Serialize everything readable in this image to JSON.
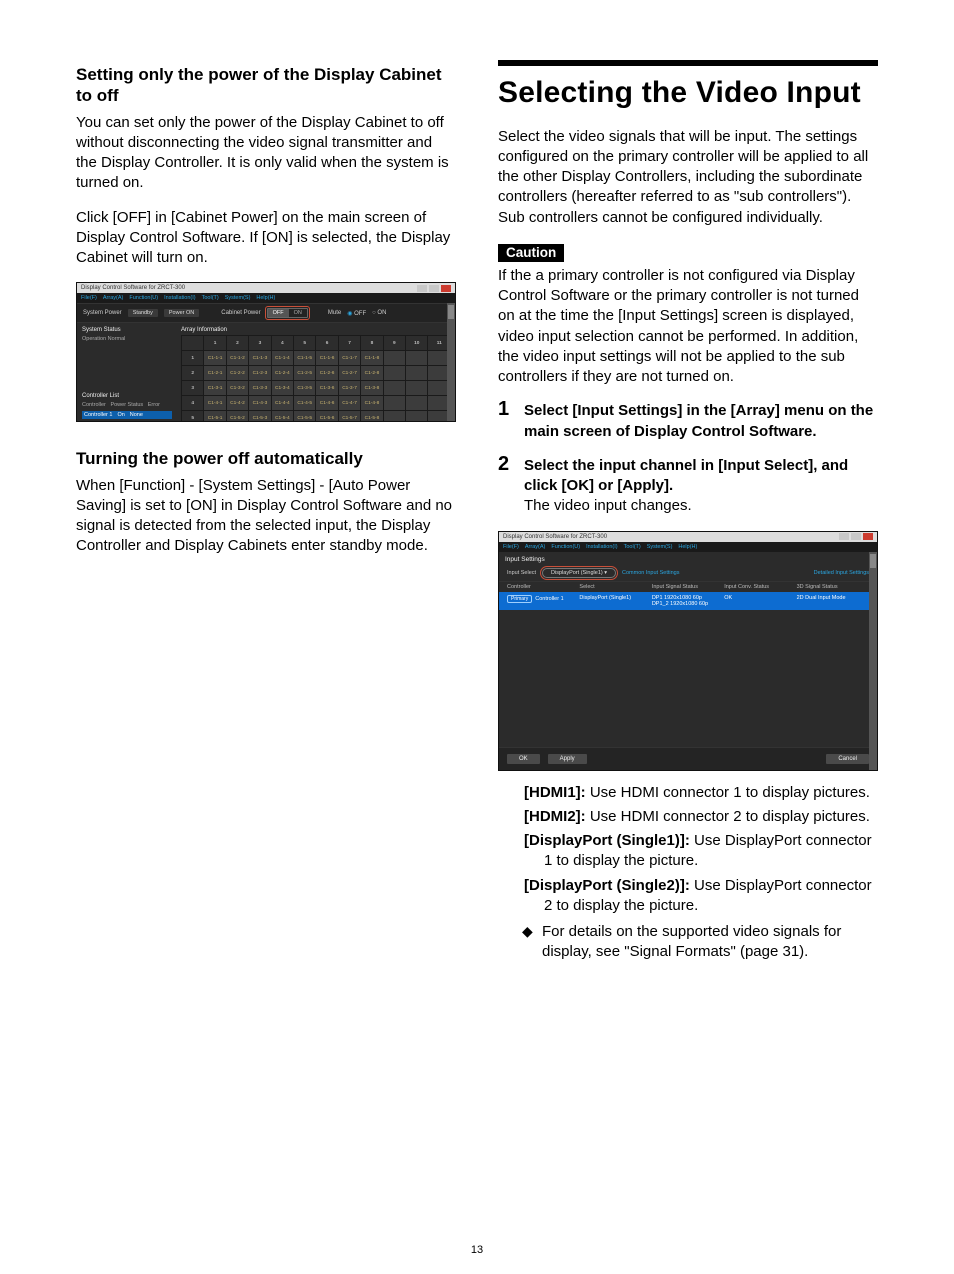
{
  "page_number": "13",
  "left": {
    "heading1": "Setting only the power of the Display Cabinet to off",
    "para1": "You can set only the power of the Display Cabinet to off without disconnecting the video signal transmitter and the Display Controller. It is only valid when the system is turned on.",
    "para2": "Click [OFF] in [Cabinet Power] on the main screen of Display Control Software. If [ON] is selected, the Display Cabinet will turn on.",
    "heading2": "Turning the power off automatically",
    "para3": "When [Function] - [System Settings] - [Auto Power Saving] is set to [ON] in Display Control Software and no signal is detected from the selected input, the Display Controller and Display Cabinets enter standby mode."
  },
  "right": {
    "title": "Selecting the Video Input",
    "intro": "Select the video signals that will be input. The settings configured on the primary controller will be applied to all the other Display Controllers, including the subordinate controllers (hereafter referred to as \"sub controllers\"). Sub controllers cannot be configured individually.",
    "caution_label": "Caution",
    "caution_text": "If the a primary controller is not configured via Display Control Software or the primary controller is not turned on at the time the [Input Settings] screen is displayed, video input selection cannot be performed. In addition, the video input settings will not be applied to the sub controllers if they are not turned on.",
    "steps": [
      {
        "title": "Select [Input Settings] in the [Array] menu on the main screen of Display Control Software.",
        "body": ""
      },
      {
        "title": "Select the input channel in [Input Select], and click [OK] or [Apply].",
        "body": "The video input changes."
      }
    ],
    "defs": [
      {
        "term": "[HDMI1]:",
        "text": " Use HDMI connector 1 to display pictures."
      },
      {
        "term": "[HDMI2]:",
        "text": " Use HDMI connector 2 to display pictures."
      },
      {
        "term": "[DisplayPort (Single1)]:",
        "text": " Use DisplayPort connector 1 to display the picture."
      },
      {
        "term": "[DisplayPort (Single2)]:",
        "text": " Use DisplayPort connector 2 to display the picture."
      }
    ],
    "note": "For details on the supported video signals for display, see \"Signal Formats\" (page 31)."
  },
  "shot_common": {
    "title": "Display Control Software for ZRCT-300",
    "menu": [
      "File(F)",
      "Array(A)",
      "Function(U)",
      "Installation(I)",
      "Tool(T)",
      "System(S)",
      "Help(H)"
    ]
  },
  "shot1": {
    "labels": {
      "system_power": "System Power",
      "standby": "Standby",
      "power_on": "Power ON",
      "cabinet_power": "Cabinet Power",
      "off": "OFF",
      "on": "ON",
      "mute": "Mute",
      "system_status": "System Status",
      "operation": "Operation Normal",
      "controller_list": "Controller List",
      "cl_controller": "Controller",
      "cl_power": "Power Status",
      "cl_error": "Error",
      "cl_row_name": "Controller 1",
      "cl_row_power": "On",
      "cl_row_error": "None",
      "array_info": "Array Information"
    },
    "grid": {
      "cols": [
        "1",
        "2",
        "3",
        "4",
        "5",
        "6",
        "7",
        "8",
        "9",
        "10",
        "11"
      ],
      "rows": [
        [
          "1",
          "C1-1-1",
          "C1-1-2",
          "C1-1-3",
          "C1-1-4",
          "C1-1-5",
          "C1-1-6",
          "C1-1-7",
          "C1-1-8",
          "",
          "",
          ""
        ],
        [
          "2",
          "C1-2-1",
          "C1-2-2",
          "C1-2-3",
          "C1-2-4",
          "C1-2-5",
          "C1-2-6",
          "C1-2-7",
          "C1-2-8",
          "",
          "",
          ""
        ],
        [
          "3",
          "C1-3-1",
          "C1-3-2",
          "C1-3-3",
          "C1-3-4",
          "C1-3-5",
          "C1-3-6",
          "C1-3-7",
          "C1-3-8",
          "",
          "",
          ""
        ],
        [
          "4",
          "C1-4-1",
          "C1-4-2",
          "C1-4-3",
          "C1-4-4",
          "C1-4-5",
          "C1-4-6",
          "C1-4-7",
          "C1-4-8",
          "",
          "",
          ""
        ],
        [
          "5",
          "C1-5-1",
          "C1-5-2",
          "C1-5-3",
          "C1-5-4",
          "C1-5-5",
          "C1-5-6",
          "C1-5-7",
          "C1-5-8",
          "",
          "",
          ""
        ]
      ]
    }
  },
  "shot2": {
    "section": "Input Settings",
    "input_select_label": "Input Select",
    "input_select_value": "DisplayPort (Single1) ▾",
    "common_link": "Common Input Settings",
    "detailed_link": "Detailed Input Settings",
    "table_headers": [
      "Controller",
      "Select",
      "Input Signal Status",
      "Input Conv. Status",
      "3D Signal Status"
    ],
    "row": {
      "primary": "Primary",
      "controller": "Controller 1",
      "select": "DisplayPort (Single1)",
      "status1a": "DP1 1920x1080 60p",
      "status1b": "DP1_2 1920x1080 60p",
      "conv": "OK",
      "three_d": "2D Dual Input Mode"
    },
    "buttons": {
      "ok": "OK",
      "apply": "Apply",
      "cancel": "Cancel"
    }
  }
}
